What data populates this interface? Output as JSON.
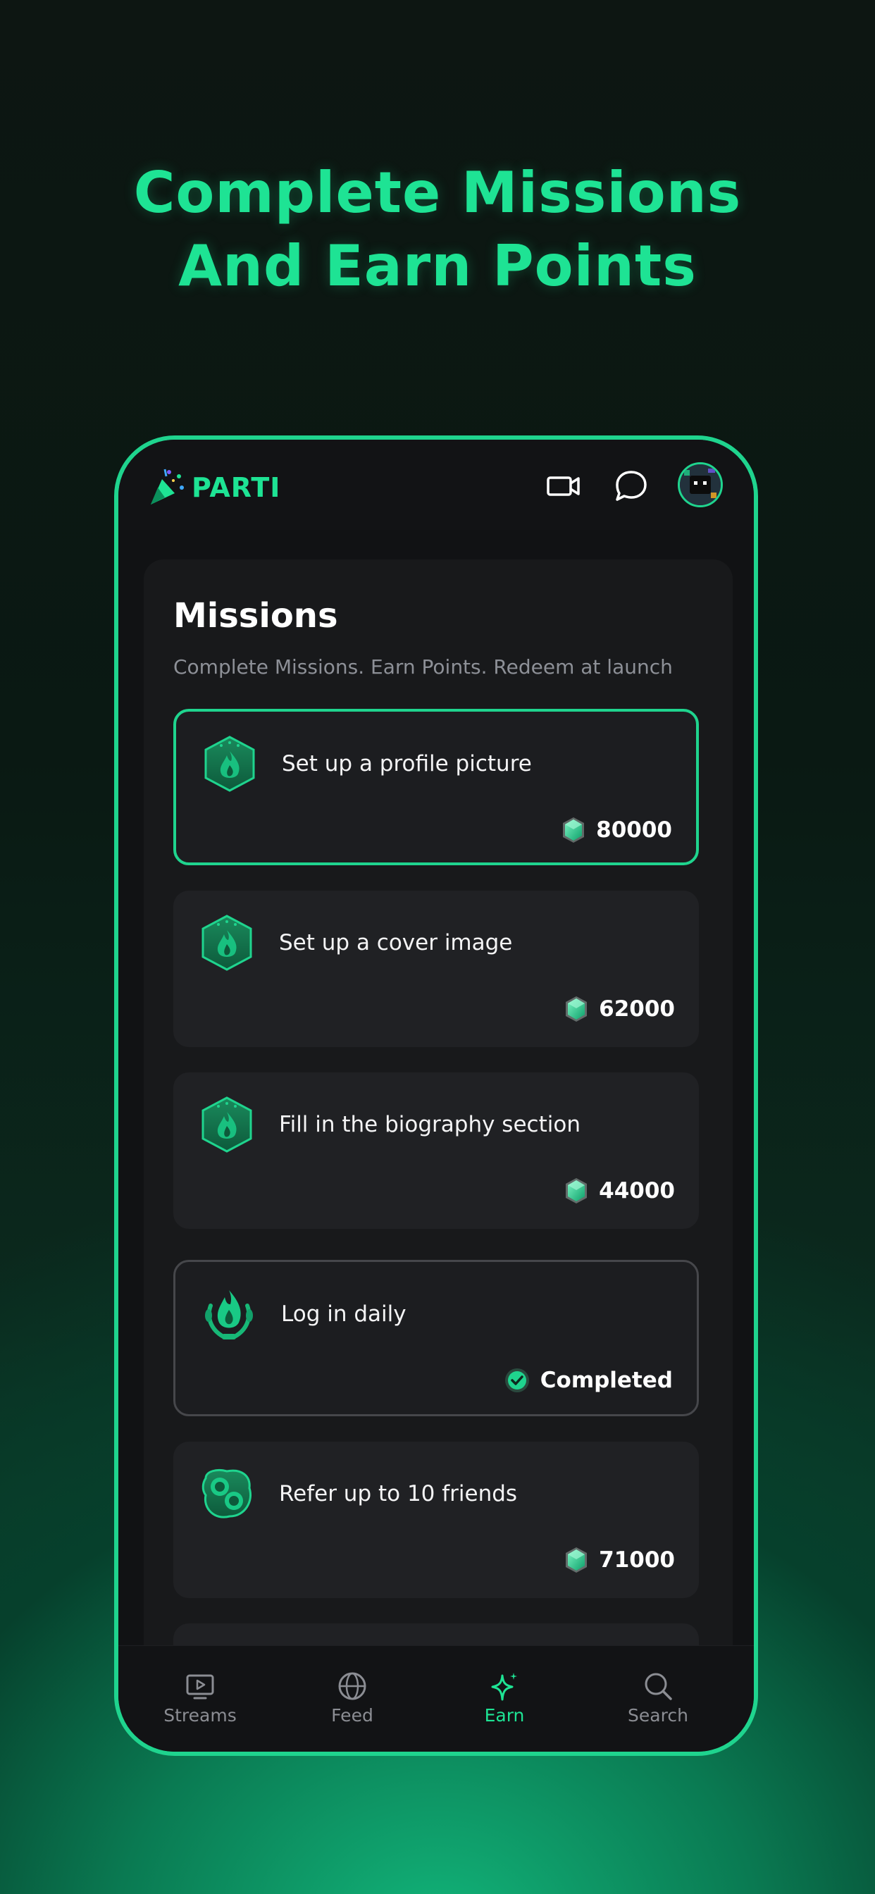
{
  "headline": {
    "line1": "Complete Missions",
    "line2": "And Earn Points"
  },
  "app": {
    "brand": "PARTI"
  },
  "header_icons": [
    "video-camera-icon",
    "chat-bubble-icon",
    "avatar"
  ],
  "missions": {
    "title": "Missions",
    "subtitle": "Complete Missions. Earn Points. Redeem at launch",
    "items": [
      {
        "title": "Set up a profile picture",
        "points": "80000",
        "state": "active",
        "icon": "flame-badge-icon"
      },
      {
        "title": "Set up a cover image",
        "points": "62000",
        "state": "available",
        "icon": "flame-badge-icon"
      },
      {
        "title": "Fill in the biography section",
        "points": "44000",
        "state": "available",
        "icon": "flame-badge-icon"
      },
      {
        "title": "Log in daily",
        "status": "Completed",
        "state": "completed",
        "icon": "laurel-flame-icon"
      },
      {
        "title": "Refer up to 10 friends",
        "points": "71000",
        "state": "available",
        "icon": "coins-badge-icon"
      }
    ]
  },
  "tabs": [
    {
      "label": "Streams",
      "icon": "tv-play-icon",
      "active": false
    },
    {
      "label": "Feed",
      "icon": "globe-icon",
      "active": false
    },
    {
      "label": "Earn",
      "icon": "sparkle-icon",
      "active": true
    },
    {
      "label": "Search",
      "icon": "search-icon",
      "active": false
    }
  ],
  "colors": {
    "accent": "#1ee394",
    "background": "#111214",
    "card": "#202124"
  }
}
